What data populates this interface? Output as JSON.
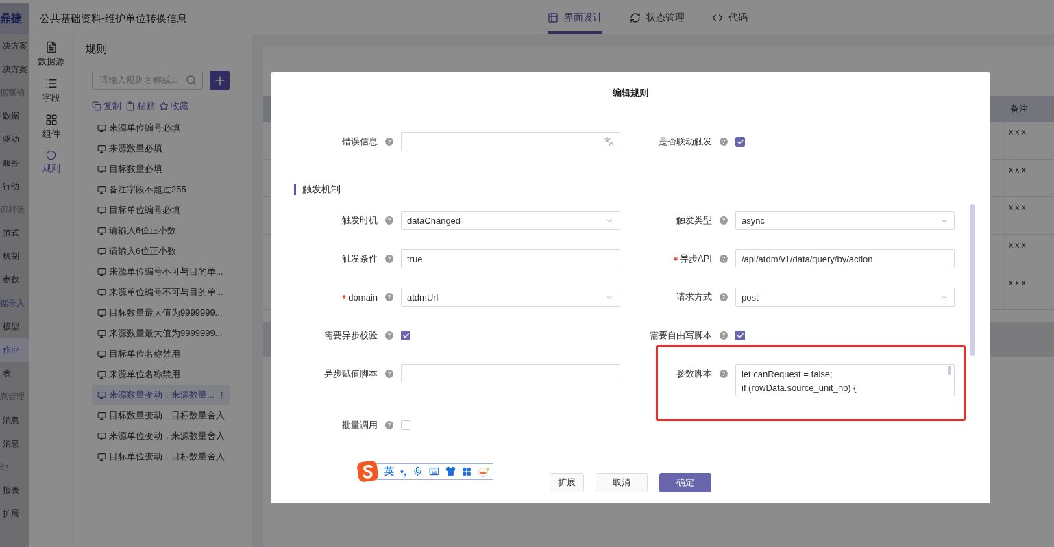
{
  "nav": {
    "logo": "鼎捷",
    "items": [
      {
        "kind": "item",
        "label": "决方案",
        "selected": false
      },
      {
        "kind": "item",
        "label": "决方案",
        "selected": false
      },
      {
        "kind": "group",
        "label": "据驱动",
        "active": false
      },
      {
        "kind": "item",
        "label": "数据",
        "selected": false
      },
      {
        "kind": "item",
        "label": "驱动",
        "selected": false
      },
      {
        "kind": "item",
        "label": "服务",
        "selected": false
      },
      {
        "kind": "item",
        "label": "行动",
        "selected": false
      },
      {
        "kind": "group",
        "label": "识封装",
        "active": false
      },
      {
        "kind": "item",
        "label": "范式",
        "selected": false
      },
      {
        "kind": "item",
        "label": "机制",
        "selected": false
      },
      {
        "kind": "item",
        "label": "参数",
        "selected": false
      },
      {
        "kind": "group",
        "label": "据录入",
        "active": true
      },
      {
        "kind": "item",
        "label": "模型",
        "selected": false
      },
      {
        "kind": "item",
        "label": "作业",
        "selected": true
      },
      {
        "kind": "item",
        "label": "表",
        "selected": false
      },
      {
        "kind": "group",
        "label": "息管理",
        "active": false
      },
      {
        "kind": "item",
        "label": "消息",
        "selected": false
      },
      {
        "kind": "item",
        "label": "消息",
        "selected": false
      },
      {
        "kind": "group",
        "label": "他",
        "active": false
      },
      {
        "kind": "item",
        "label": "报表",
        "selected": false
      },
      {
        "kind": "item",
        "label": "扩展",
        "selected": false
      }
    ]
  },
  "header": {
    "title": "公共基础资料-维护单位转换信息",
    "tabs": [
      {
        "kind": "grid",
        "label": "界面设计",
        "selected": true
      },
      {
        "kind": "refresh",
        "label": "状态管理",
        "selected": false
      },
      {
        "kind": "code",
        "label": "代码",
        "selected": false
      }
    ]
  },
  "rail": [
    {
      "kind": "datasource",
      "label": "数据源",
      "selected": false
    },
    {
      "kind": "list",
      "label": "字段",
      "selected": false
    },
    {
      "kind": "components",
      "label": "组件",
      "selected": false
    },
    {
      "kind": "rules",
      "label": "规则",
      "selected": true
    }
  ],
  "rules_panel": {
    "title": "规则",
    "search": {
      "placeholder": "请输入规则名称或..."
    },
    "actions": [
      {
        "kind": "copy",
        "label": "复制"
      },
      {
        "kind": "paste",
        "label": "粘贴"
      },
      {
        "kind": "favorite",
        "label": "收藏"
      }
    ],
    "items": [
      {
        "label": "来源单位编号必填",
        "selected": false
      },
      {
        "label": "来源数量必填",
        "selected": false
      },
      {
        "label": "目标数量必填",
        "selected": false
      },
      {
        "label": "备注字段不超过255",
        "selected": false
      },
      {
        "label": "目标单位编号必填",
        "selected": false
      },
      {
        "label": "请输入6位正小数",
        "selected": false
      },
      {
        "label": "请输入6位正小数",
        "selected": false
      },
      {
        "label": "来源单位编号不可与目的单...",
        "selected": false
      },
      {
        "label": "来源单位编号不可与目的单...",
        "selected": false
      },
      {
        "label": "目标数量最大值为9999999...",
        "selected": false
      },
      {
        "label": "来源数量最大值为9999999...",
        "selected": false
      },
      {
        "label": "目标单位名称禁用",
        "selected": false
      },
      {
        "label": "来源单位名称禁用",
        "selected": false
      },
      {
        "label": "来源数量变动，来源数量...",
        "selected": true
      },
      {
        "label": "目标数量变动，目标数量舍入",
        "selected": false
      },
      {
        "label": "来源单位变动，来源数量舍入",
        "selected": false
      },
      {
        "label": "目标单位变动，目标数量舍入",
        "selected": false
      }
    ]
  },
  "table": {
    "columns": [
      "备注"
    ],
    "rows": [
      [
        "x x x"
      ],
      [
        "x x x"
      ],
      [
        "x x x"
      ],
      [
        "x x x"
      ],
      [
        "x x x"
      ]
    ]
  },
  "dialog": {
    "title": "编辑规则",
    "rows": [
      {
        "kind": "fields",
        "cells": [
          {
            "kind": "multilang",
            "label": "错误信息",
            "required": false
          },
          {
            "kind": "checkbox",
            "label": "是否联动触发",
            "required": false,
            "checked": true
          }
        ]
      },
      {
        "kind": "section",
        "title": "触发机制"
      },
      {
        "kind": "fields",
        "cells": [
          {
            "kind": "select",
            "label": "触发时机",
            "required": false,
            "value": "dataChanged"
          },
          {
            "kind": "select",
            "label": "触发类型",
            "required": false,
            "value": "async"
          }
        ]
      },
      {
        "kind": "fields",
        "cells": [
          {
            "kind": "input",
            "label": "触发条件",
            "required": false,
            "value": "true"
          },
          {
            "kind": "input",
            "label": "异步API",
            "required": true,
            "value": "/api/atdm/v1/data/query/by/action"
          }
        ]
      },
      {
        "kind": "fields",
        "cells": [
          {
            "kind": "select",
            "label": "domain",
            "required": true,
            "value": "atdmUrl"
          },
          {
            "kind": "select",
            "label": "请求方式",
            "required": false,
            "value": "post"
          }
        ]
      },
      {
        "kind": "fields",
        "cells": [
          {
            "kind": "checkbox",
            "label": "需要异步校验",
            "required": false,
            "checked": true
          },
          {
            "kind": "checkbox",
            "label": "需要自由写脚本",
            "required": false,
            "checked": true
          }
        ]
      },
      {
        "kind": "fields",
        "cells": [
          {
            "kind": "input",
            "label": "异步赋值脚本",
            "required": false
          },
          {
            "kind": "textarea",
            "label": "参数脚本",
            "required": false,
            "highlighted": true,
            "value": "let canRequest = false;\nif (rowData.source_unit_no) {"
          }
        ]
      },
      {
        "kind": "fields",
        "cells": [
          {
            "kind": "checkbox",
            "label": "批量调用",
            "required": false,
            "checked": false
          }
        ]
      }
    ],
    "buttons": [
      {
        "kind": "default",
        "label": "扩展"
      },
      {
        "kind": "default",
        "label": "取消"
      },
      {
        "kind": "primary",
        "label": "确定"
      }
    ]
  },
  "ime": {
    "mode": "英",
    "punctuation": "•,"
  }
}
